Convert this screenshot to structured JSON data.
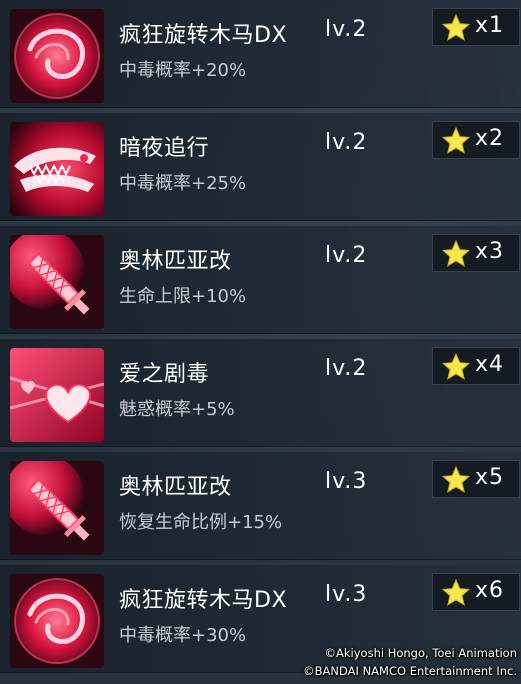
{
  "skills": [
    {
      "name": "疯狂旋转木马DX",
      "level": "lv.2",
      "effect": "中毒概率+20%",
      "count": "x1",
      "icon": "spiral-slash-icon"
    },
    {
      "name": "暗夜追行",
      "level": "lv.2",
      "effect": "中毒概率+25%",
      "count": "x2",
      "icon": "beast-bite-icon"
    },
    {
      "name": "奥林匹亚改",
      "level": "lv.2",
      "effect": "生命上限+10%",
      "count": "x3",
      "icon": "blade-icon"
    },
    {
      "name": "爱之剧毒",
      "level": "lv.2",
      "effect": "魅惑概率+5%",
      "count": "x4",
      "icon": "heart-beam-icon"
    },
    {
      "name": "奥林匹亚改",
      "level": "lv.3",
      "effect": "恢复生命比例+15%",
      "count": "x5",
      "icon": "blade-icon"
    },
    {
      "name": "疯狂旋转木马DX",
      "level": "lv.3",
      "effect": "中毒概率+30%",
      "count": "x6",
      "icon": "spiral-slash-icon"
    }
  ],
  "colors": {
    "icon_primary": "#ff2a55",
    "star": "#f6e84a"
  },
  "copyright": {
    "line1": "©Akiyoshi Hongo, Toei Animation",
    "line2": "©BANDAI NAMCO Entertainment Inc."
  }
}
